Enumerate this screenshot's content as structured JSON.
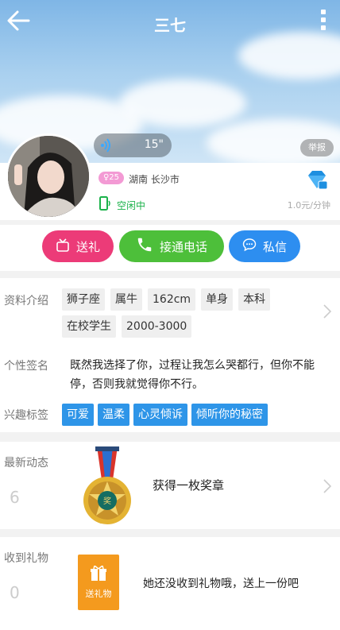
{
  "header": {
    "title": "三七"
  },
  "voice": {
    "duration": "15\""
  },
  "report": {
    "label": "举报"
  },
  "profile": {
    "age": "25",
    "location": "湖南 长沙市",
    "status": "空闲中",
    "price": "1.0元/分钟"
  },
  "actions": {
    "gift_label": "送礼",
    "call_label": "接通电话",
    "message_label": "私信"
  },
  "details": {
    "intro_label": "资料介绍",
    "intro_tags": [
      "狮子座",
      "属牛",
      "162cm",
      "单身",
      "本科",
      "在校学生",
      "2000-3000"
    ],
    "signature_label": "个性签名",
    "signature": "既然我选择了你，过程让我怎么哭都行，但你不能停，否则我就觉得你不行。",
    "interest_label": "兴趣标签",
    "interest_tags": [
      "可爱",
      "温柔",
      "心灵倾诉",
      "倾听你的秘密"
    ]
  },
  "moments": {
    "label": "最新动态",
    "count": "6",
    "text": "获得一枚奖章"
  },
  "gifts": {
    "label": "收到礼物",
    "count": "0",
    "box_label": "送礼物",
    "text": "她还没收到礼物哦，送上一份吧"
  },
  "colors": {
    "gift_button": "#ec3b78",
    "call_button": "#4dbf3a",
    "message_button": "#2d8ef0",
    "tag_blue": "#2e95e8",
    "status_green": "#1bb24a"
  }
}
